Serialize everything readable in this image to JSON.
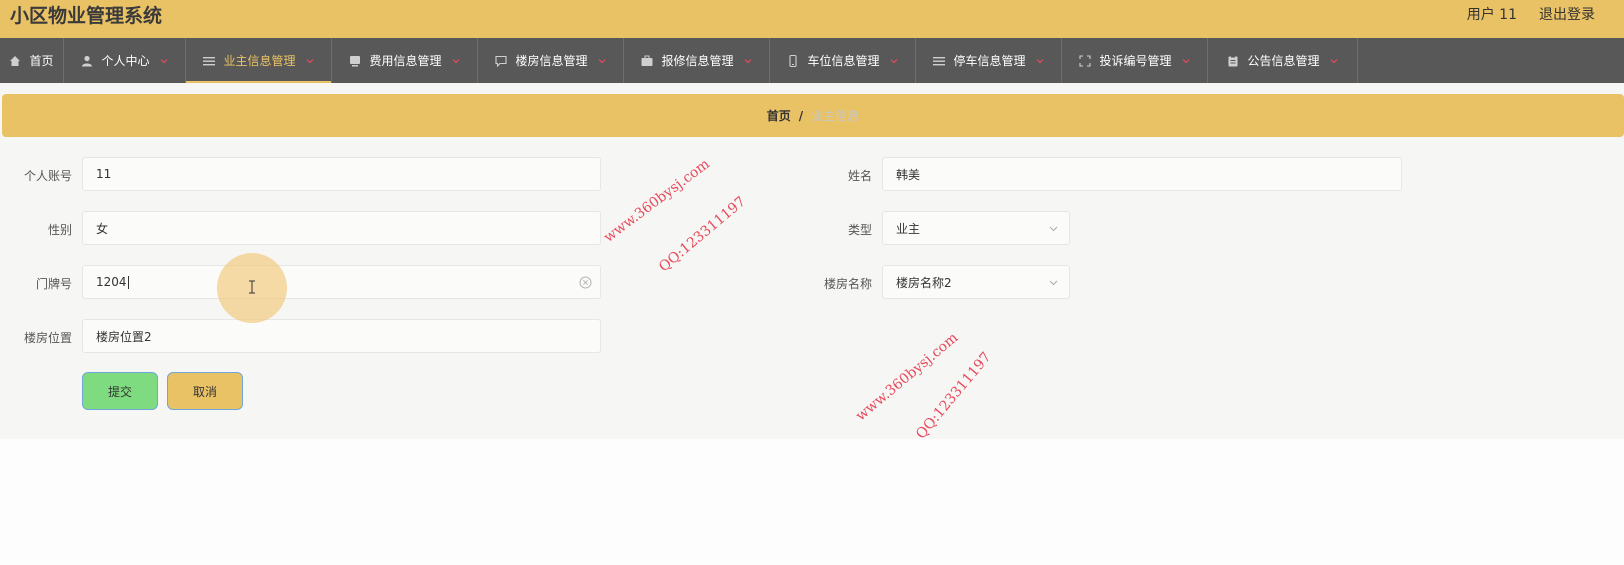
{
  "header": {
    "title": "小区物业管理系统",
    "user": "用户 11",
    "logout": "退出登录"
  },
  "nav": [
    {
      "label": "首页",
      "icon": "home-icon"
    },
    {
      "label": "个人中心",
      "icon": "user-icon"
    },
    {
      "label": "业主信息管理",
      "icon": "list-icon",
      "active": true
    },
    {
      "label": "费用信息管理",
      "icon": "monitor-icon"
    },
    {
      "label": "楼房信息管理",
      "icon": "chat-icon"
    },
    {
      "label": "报修信息管理",
      "icon": "briefcase-icon"
    },
    {
      "label": "车位信息管理",
      "icon": "phone-icon"
    },
    {
      "label": "停车信息管理",
      "icon": "list-icon"
    },
    {
      "label": "投诉编号管理",
      "icon": "fullscreen-icon"
    },
    {
      "label": "公告信息管理",
      "icon": "clipboard-icon"
    }
  ],
  "breadcrumb": {
    "home": "首页",
    "separator": "/",
    "current": "业主信息"
  },
  "form": {
    "account_label": "个人账号",
    "account_value": "11",
    "name_label": "姓名",
    "name_value": "韩美",
    "gender_label": "性别",
    "gender_value": "女",
    "type_label": "类型",
    "type_value": "业主",
    "door_label": "门牌号",
    "door_value": "1204",
    "building_name_label": "楼房名称",
    "building_name_value": "楼房名称2",
    "building_location_label": "楼房位置",
    "building_location_value": "楼房位置2",
    "submit_label": "提交",
    "cancel_label": "取消"
  },
  "watermark": {
    "site": "www.360bysj.com",
    "qq": "QQ:123311197"
  },
  "colors": {
    "header": "#eac266",
    "nav": "#585858",
    "submit": "#7fdb7f",
    "watermark": "#e8495a"
  }
}
